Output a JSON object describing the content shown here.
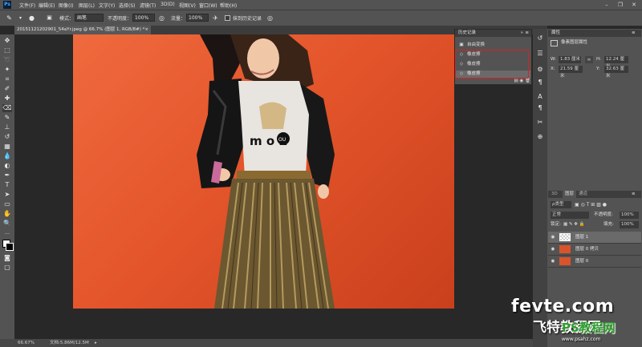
{
  "app": {
    "logo": "Ps"
  },
  "menu": [
    "文件(F)",
    "编辑(E)",
    "图像(I)",
    "图层(L)",
    "文字(Y)",
    "选择(S)",
    "滤镜(T)",
    "3D(D)",
    "视图(V)",
    "窗口(W)",
    "帮助(H)"
  ],
  "window_controls": {
    "minimize": "–",
    "restore": "❐",
    "close": "✕"
  },
  "options": {
    "mode_label": "模式：",
    "mode_value": "画笔",
    "opacity_label": "不透明度：",
    "opacity_value": "100%",
    "flow_label": "流量：",
    "flow_value": "100%",
    "erase_history_label": "抹到历史记录"
  },
  "document": {
    "tab_title": "20151121202901_54aYr.jpeg @ 66.7% (图层 1, RGB/8#) *"
  },
  "status": {
    "zoom": "66.67%",
    "doc_info": "文档:5.86M/12.5M"
  },
  "history_panel": {
    "tabs": [
      "历史记录"
    ],
    "items": [
      {
        "label": "自由变换",
        "icon": "transform-icon"
      },
      {
        "label": "橡皮擦",
        "icon": "eraser-icon"
      },
      {
        "label": "橡皮擦",
        "icon": "eraser-icon"
      },
      {
        "label": "橡皮擦",
        "icon": "eraser-icon"
      }
    ]
  },
  "properties_panel": {
    "tab": "属性",
    "title": "像素图层属性",
    "w_label": "W:",
    "w_value": "1.83 厘米",
    "h_label": "H:",
    "h_value": "12.24 厘米",
    "x_label": "X:",
    "x_value": "21.59 厘米",
    "y_label": "Y:",
    "y_value": "32.63 厘米"
  },
  "layers_panel": {
    "tabs": [
      "3D",
      "图层",
      "通道"
    ],
    "kind_label": "ρ类型",
    "blend_mode": "正常",
    "opacity_label": "不透明度:",
    "opacity_value": "100%",
    "lock_label": "锁定:",
    "fill_label": "填充:",
    "fill_value": "100%",
    "layers": [
      {
        "name": "图层 1",
        "thumb": "checker"
      },
      {
        "name": "图层 0 拷贝",
        "thumb": "photo"
      },
      {
        "name": "图层 0",
        "thumb": "photo"
      }
    ]
  },
  "image_text": {
    "tshirt": "m o k",
    "badge": "OU"
  },
  "watermark": {
    "line1": "fevte.com",
    "line2": "飞特教程网",
    "line3": "www.psahz.com",
    "line4": "PS教程网"
  },
  "colors": {
    "accent_red": "#e01e1e",
    "ps_blue": "#3fa9f5",
    "photo_bg": "#e4552b"
  }
}
